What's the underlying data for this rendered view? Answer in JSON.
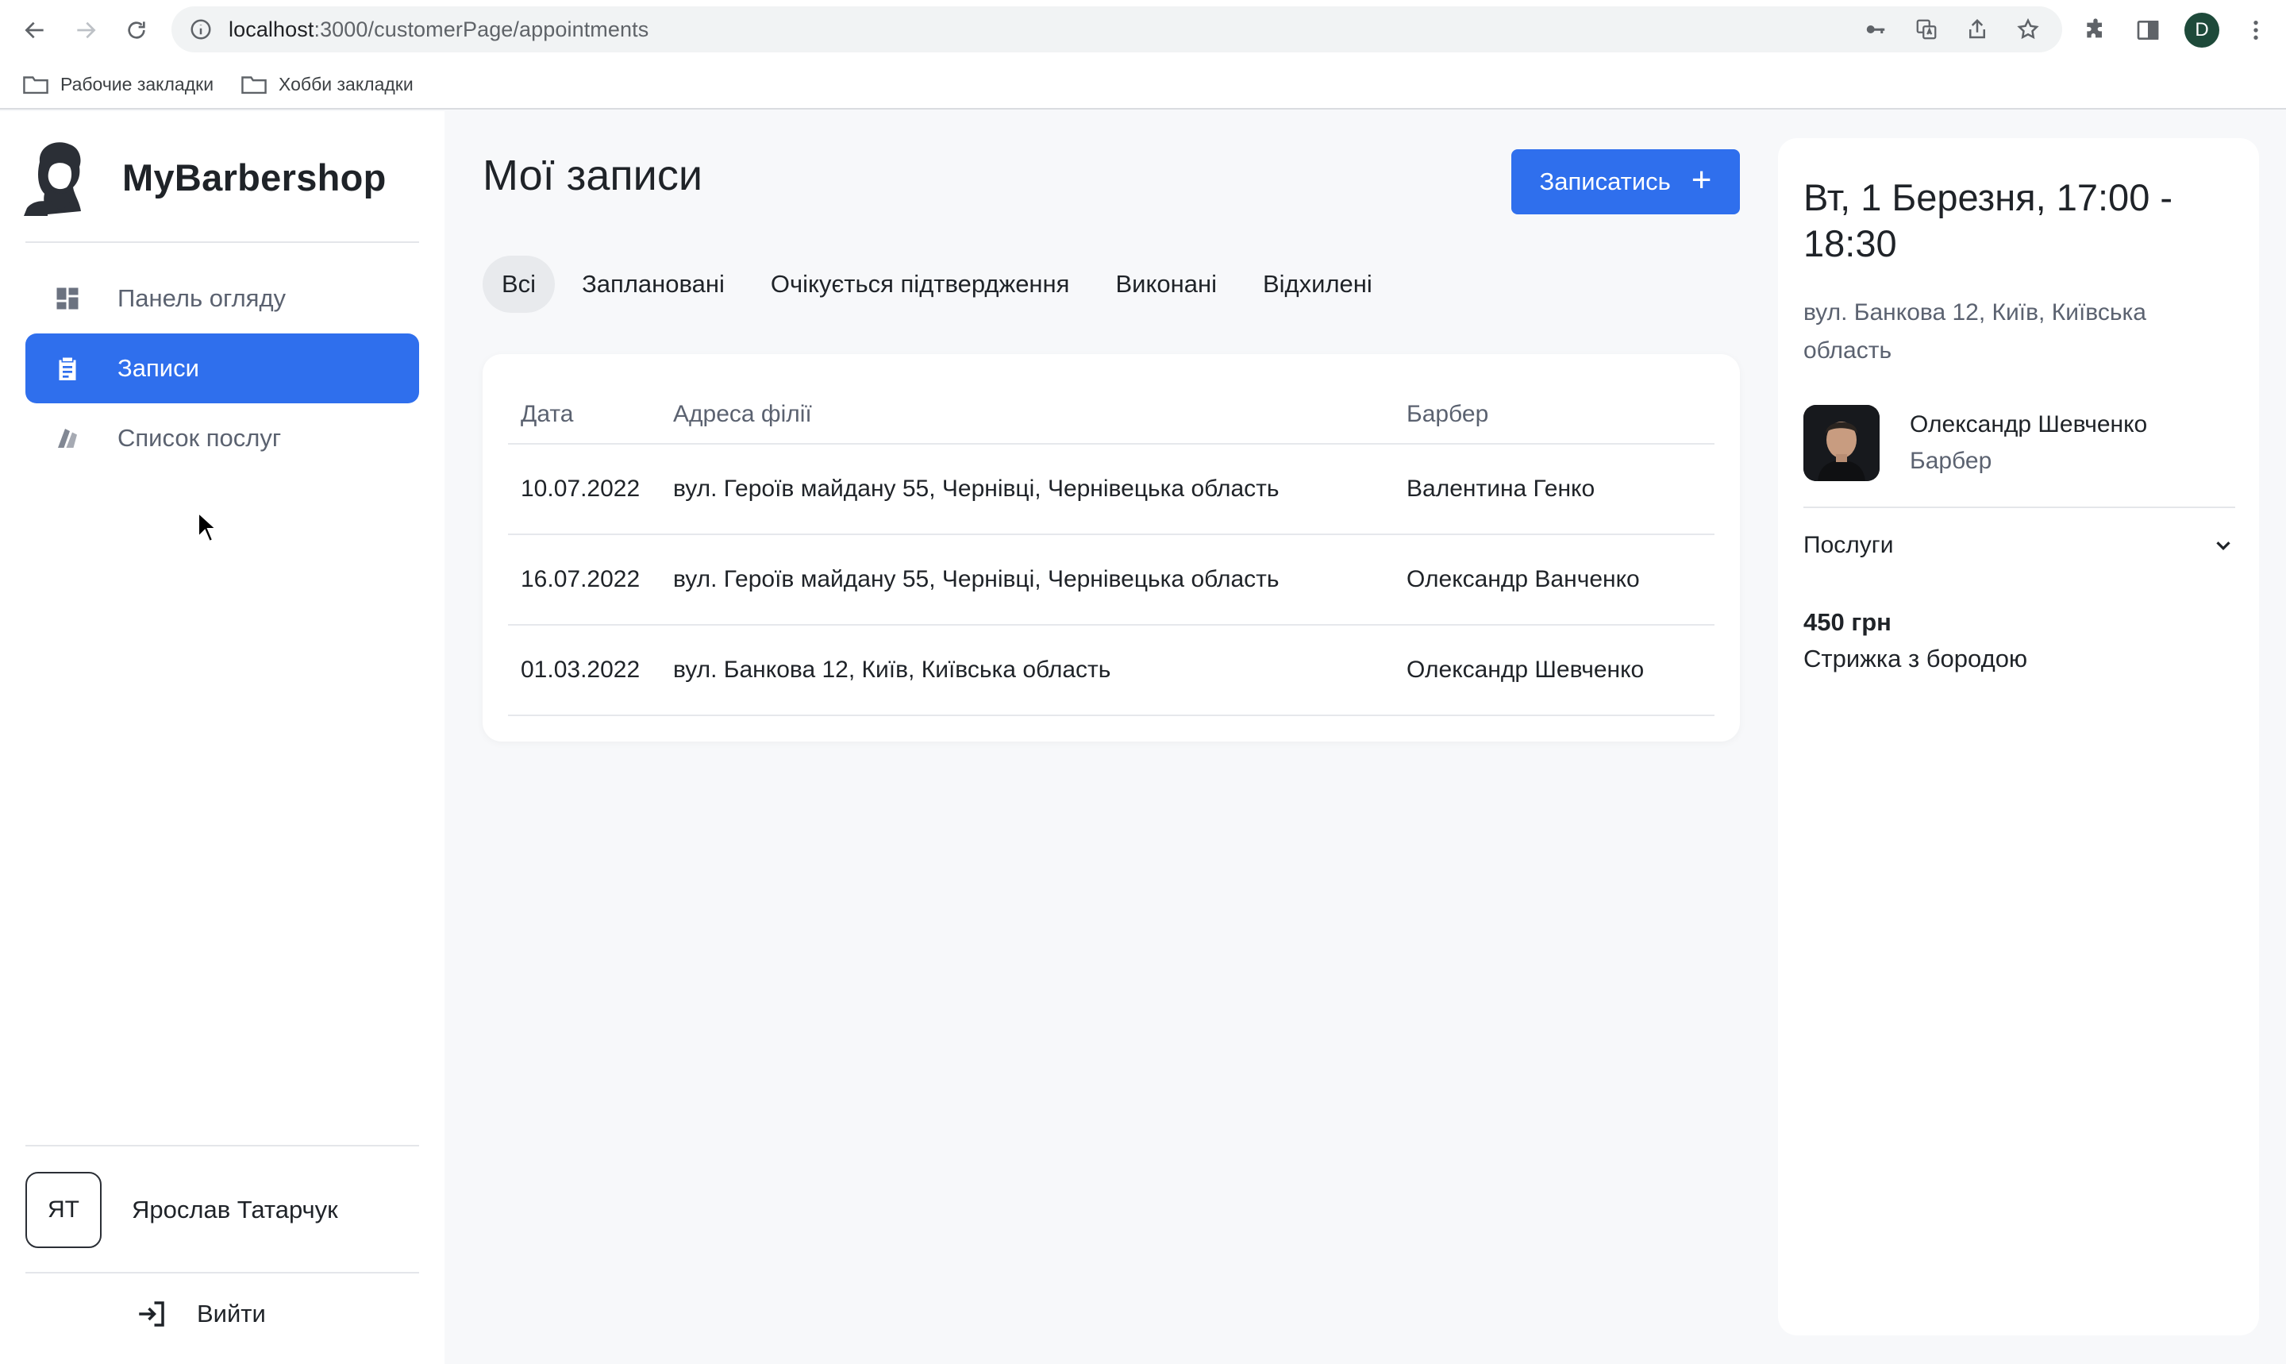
{
  "browser": {
    "url_host": "localhost",
    "url_path": ":3000/customerPage/appointments",
    "profile_initial": "D",
    "bookmarks": [
      {
        "label": "Рабочие закладки",
        "icon": "folder-icon"
      },
      {
        "label": "Хобби закладки",
        "icon": "folder-icon"
      }
    ]
  },
  "sidebar": {
    "brand": "MyBarbershop",
    "items": [
      {
        "label": "Панель огляду",
        "icon": "dashboard-icon",
        "active": false
      },
      {
        "label": "Записи",
        "icon": "clipboard-icon",
        "active": true
      },
      {
        "label": "Список послуг",
        "icon": "scissors-icon",
        "active": false
      }
    ],
    "user": {
      "initials": "ЯТ",
      "name": "Ярослав Татарчук"
    },
    "logout_label": "Вийти"
  },
  "main": {
    "title": "Мої записи",
    "book_button": {
      "label": "Записатись",
      "icon": "plus-icon"
    },
    "tabs": [
      {
        "label": "Всі",
        "active": true
      },
      {
        "label": "Заплановані",
        "active": false
      },
      {
        "label": "Очікується підтвердження",
        "active": false
      },
      {
        "label": "Виконані",
        "active": false
      },
      {
        "label": "Відхилені",
        "active": false
      }
    ],
    "table": {
      "headers": {
        "date": "Дата",
        "address": "Адреса філії",
        "barber": "Барбер"
      },
      "rows": [
        {
          "date": "10.07.2022",
          "address": "вул. Героїв майдану 55, Чернівці, Чернівецька область",
          "barber": "Валентина Генко"
        },
        {
          "date": "16.07.2022",
          "address": "вул. Героїв майдану 55, Чернівці, Чернівецька область",
          "barber": "Олександр Ванченко"
        },
        {
          "date": "01.03.2022",
          "address": "вул. Банкова 12, Київ, Київська область",
          "barber": "Олександр Шевченко"
        }
      ]
    }
  },
  "detail": {
    "title": "Вт, 1 Березня, 17:00 - 18:30",
    "address": "вул. Банкова 12, Київ, Київська область",
    "barber_name": "Олександр Шевченко",
    "barber_role": "Барбер",
    "services_label": "Послуги",
    "price": "450 грн",
    "service_name": "Стрижка з бородою"
  },
  "colors": {
    "accent": "#2f6fed",
    "page_bg": "#f7f8fa",
    "card_bg": "#ffffff",
    "muted_text": "#5b6270"
  }
}
